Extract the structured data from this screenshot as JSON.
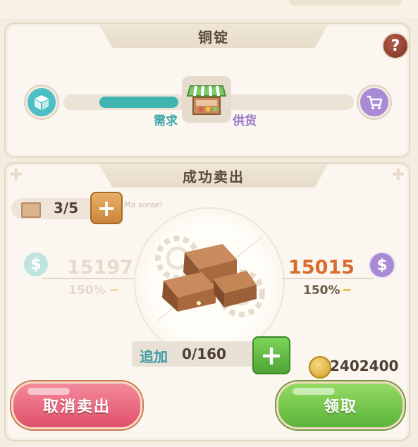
{
  "market": {
    "title": "铜锭",
    "help_label": "?",
    "demand_label": "需求",
    "supply_label": "供货",
    "demand_level": 0.6
  },
  "sale": {
    "title": "成功卖出",
    "slots_text": "3/5",
    "signature": "Ma sorae!",
    "base_price": "15197",
    "base_pct": "150%",
    "sell_price": "15015",
    "sell_pct": "150%",
    "add_label": "追加",
    "add_count": "0/160",
    "gold_amount": "2402400"
  },
  "buttons": {
    "cancel_label": "取消卖出",
    "claim_label": "领取",
    "plus_symbol": "+"
  },
  "currency_symbol": "$",
  "colors": {
    "demand": "#3fb4b1",
    "supply": "#a98ad4",
    "sell_price": "#d96d2e",
    "cancel_button": "#e0506a",
    "claim_button": "#5cb43b"
  },
  "icons": [
    "demand-box-icon",
    "shop-stall-icon",
    "cart-icon",
    "gold-coin-icon",
    "copper-ingot-icon",
    "gear-icon",
    "scroll-icon"
  ]
}
